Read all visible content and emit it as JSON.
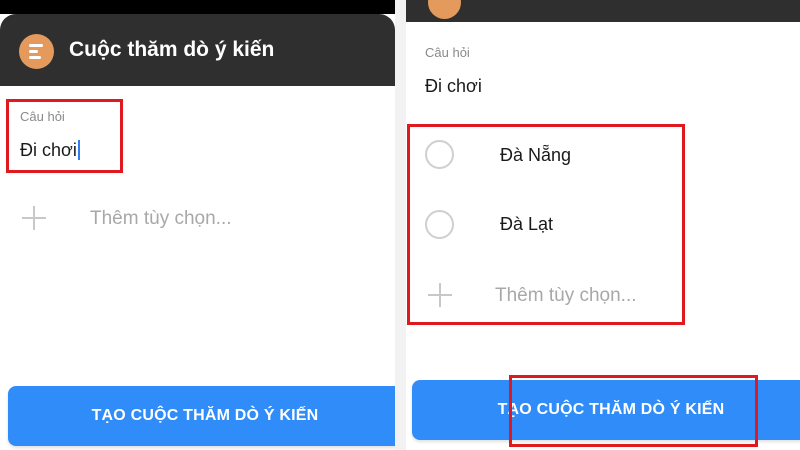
{
  "colors": {
    "header_bg": "#2f2f2f",
    "logo_bg": "#e39a5c",
    "accent_blue": "#2f8cf8",
    "highlight_red": "#e0191f"
  },
  "left": {
    "header": {
      "title": "Cuộc thăm dò ý kiến",
      "logo_icon": "poll-icon"
    },
    "question": {
      "label": "Câu hỏi",
      "value": "Đi chơi"
    },
    "add_option": {
      "placeholder": "Thêm tùy chọn...",
      "icon": "plus-icon"
    },
    "create_button": {
      "label": "TẠO CUỘC THĂM DÒ Ý KIẾN"
    }
  },
  "right": {
    "question": {
      "label": "Câu hỏi",
      "value": "Đi chơi"
    },
    "options": [
      {
        "label": "Đà Nẵng"
      },
      {
        "label": "Đà Lạt"
      }
    ],
    "add_option": {
      "placeholder": "Thêm tùy chọn...",
      "icon": "plus-icon"
    },
    "create_button": {
      "label": "TẠO CUỘC THĂM DÒ Ý KIẾN"
    }
  }
}
